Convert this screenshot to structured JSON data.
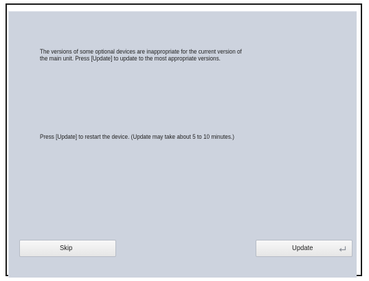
{
  "dialog": {
    "message_line_1": "The versions of some optional devices are inappropriate for the current version of",
    "message_line_2": "the main unit. Press [Update] to update to the most appropriate versions.",
    "restart_message": "Press [Update] to restart the device. (Update may take about 5 to 10 minutes.)"
  },
  "buttons": {
    "skip_label": "Skip",
    "update_label": "Update",
    "update_icon": "enter-return-icon"
  },
  "colors": {
    "panel_background": "#cdd3de",
    "button_background": "#f0f0f0",
    "text": "#1e1e1e"
  }
}
